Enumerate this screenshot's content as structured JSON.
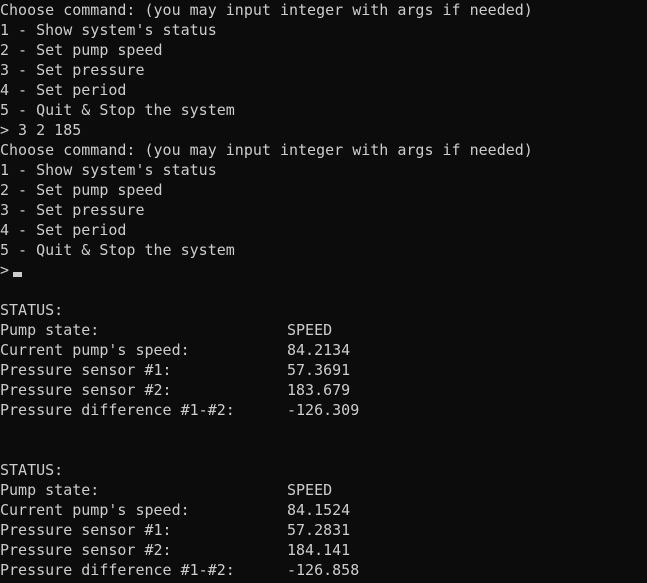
{
  "terminal": {
    "block1": {
      "prompt": "Choose command: (you may input integer with args if needed)",
      "options": [
        "1 - Show system's status",
        "2 - Set pump speed",
        "3 - Set pressure",
        "4 - Set period",
        "5 - Quit & Stop the system"
      ],
      "input": "> 3 2 185"
    },
    "block2": {
      "prompt": "Choose command: (you may input integer with args if needed)",
      "options": [
        "1 - Show system's status",
        "2 - Set pump speed",
        "3 - Set pressure",
        "4 - Set period",
        "5 - Quit & Stop the system"
      ],
      "input": ">"
    },
    "status1": {
      "header": "STATUS:",
      "rows": [
        {
          "label": "Pump state:",
          "value": "SPEED"
        },
        {
          "label": "Current pump's speed:",
          "value": "84.2134"
        },
        {
          "label": "Pressure sensor #1:",
          "value": "57.3691"
        },
        {
          "label": "Pressure sensor #2:",
          "value": "183.679"
        },
        {
          "label": "Pressure difference #1-#2:",
          "value": "-126.309"
        }
      ]
    },
    "status2": {
      "header": "STATUS:",
      "rows": [
        {
          "label": "Pump state:",
          "value": "SPEED"
        },
        {
          "label": "Current pump's speed:",
          "value": "84.1524"
        },
        {
          "label": "Pressure sensor #1:",
          "value": "57.2831"
        },
        {
          "label": "Pressure sensor #2:",
          "value": "184.141"
        },
        {
          "label": "Pressure difference #1-#2:",
          "value": "-126.858"
        }
      ]
    }
  }
}
